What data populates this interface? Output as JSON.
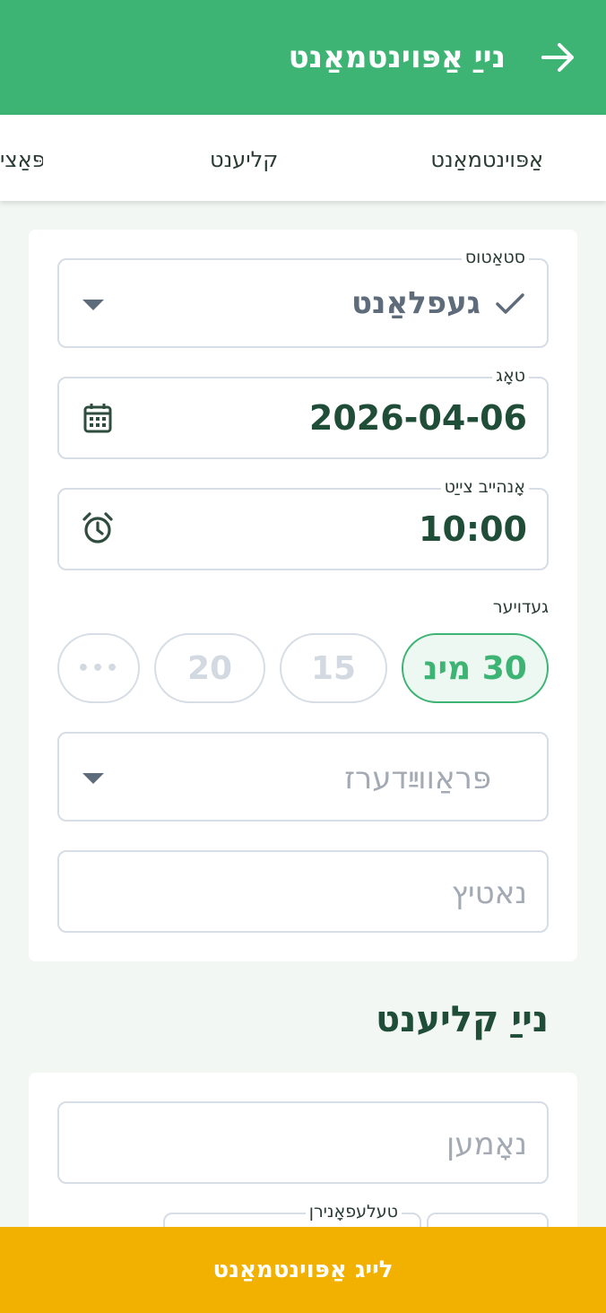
{
  "appbar": {
    "title": "נייַ אַפּוינטמאַנט",
    "back_icon": "arrow-right-icon"
  },
  "tabs": [
    {
      "label": "אַפּוינטמאַנט"
    },
    {
      "label": "קליענט"
    },
    {
      "label": "פּאַצי"
    }
  ],
  "appointment": {
    "status": {
      "label": "סטאַטוס",
      "value": "געפלאַנט",
      "icon": "check-icon"
    },
    "date": {
      "label": "טאָג",
      "value": "2026-04-06",
      "icon": "calendar-icon"
    },
    "time": {
      "label": "אָנהייב צייַט",
      "value": "10:00",
      "icon": "alarm-clock-icon"
    },
    "duration": {
      "label": "געדויער",
      "options": [
        "30 מינ",
        "15",
        "20",
        "•••"
      ],
      "selected": "30 מינ"
    },
    "providers": {
      "placeholder": "פּראַווײַדערז"
    },
    "notes": {
      "placeholder": "נאטיץ"
    }
  },
  "new_client": {
    "title": "נייַ קליענט",
    "name": {
      "placeholder": "נאָמען"
    },
    "phone": {
      "label": "טעלעפאָנירן"
    }
  },
  "footer": {
    "submit_label": "לייג אַפּוינטמאַנט"
  },
  "colors": {
    "primary": "#3db374",
    "accent": "#f2b100",
    "dark_text": "#1f4d38"
  }
}
